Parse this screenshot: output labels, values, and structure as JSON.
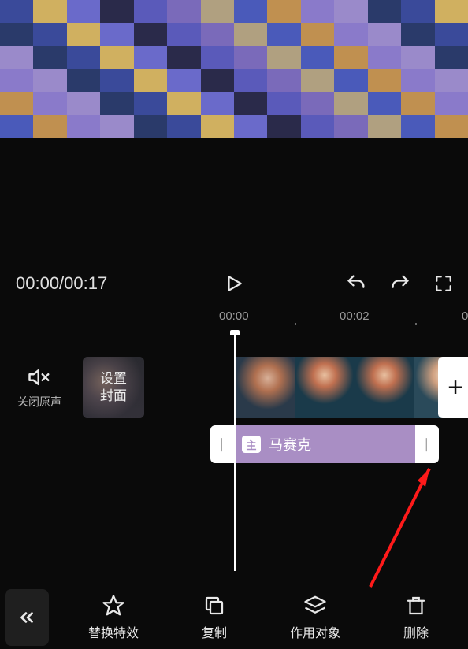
{
  "player": {
    "time_display": "00:00/00:17",
    "ruler": {
      "mark1": "00:00",
      "mark2": "00:02",
      "mark3": "0"
    }
  },
  "timeline": {
    "mute_label": "关闭原声",
    "cover_line1": "设置",
    "cover_line2": "封面",
    "effect": {
      "badge": "主",
      "name": "马赛克"
    },
    "add_clip_glyph": "+"
  },
  "toolbar": {
    "replace_effect": "替换特效",
    "copy": "复制",
    "target": "作用对象",
    "delete": "删除"
  }
}
